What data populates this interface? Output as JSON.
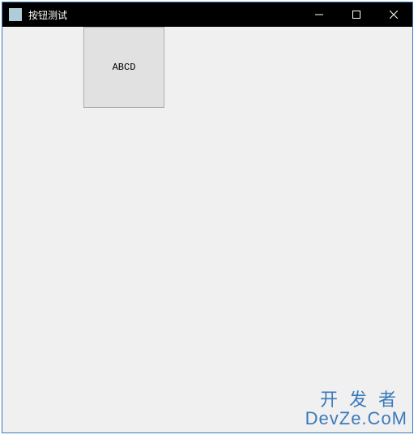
{
  "window": {
    "title": "按钮测试"
  },
  "button": {
    "label": "ABCD"
  },
  "watermark": {
    "line1": "开发者",
    "line2": "DevZe.CoM"
  }
}
